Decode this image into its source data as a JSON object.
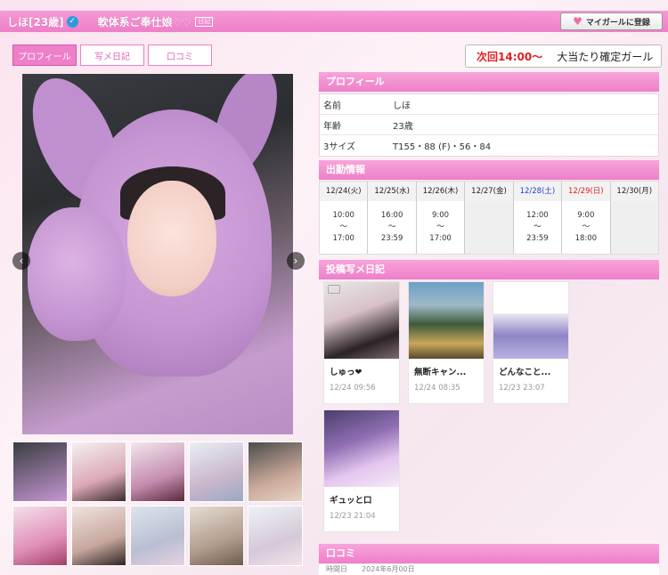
{
  "header": {
    "name_age": "しほ[23歳]",
    "catch_copy": "軟体系ご奉仕娘♡♡",
    "badge": "日記",
    "mygirl_button": "マイガールに登録"
  },
  "tabs": [
    {
      "label": "プロフィール"
    },
    {
      "label": "写メ日記"
    },
    {
      "label": "口コミ"
    }
  ],
  "next_attendance": {
    "time": "次回14:00〜",
    "label": "大当たり確定ガール"
  },
  "profile": {
    "heading": "プロフィール",
    "rows": [
      {
        "key": "名前",
        "value": "しほ"
      },
      {
        "key": "年齢",
        "value": "23歳"
      },
      {
        "key": "3サイズ",
        "value": "T155・88 (F)・56・84"
      }
    ]
  },
  "schedule": {
    "heading": "出勤情報",
    "days": [
      {
        "date": "12/24(火)",
        "start": "10:00",
        "sep": "〜",
        "end": "17:00"
      },
      {
        "date": "12/25(水)",
        "start": "16:00",
        "sep": "〜",
        "end": "23:59"
      },
      {
        "date": "12/26(木)",
        "start": "9:00",
        "sep": "〜",
        "end": "17:00"
      },
      {
        "date": "12/27(金)",
        "start": "",
        "sep": "",
        "end": ""
      },
      {
        "date": "12/28(土)",
        "start": "12:00",
        "sep": "〜",
        "end": "23:59"
      },
      {
        "date": "12/29(日)",
        "start": "9:00",
        "sep": "〜",
        "end": "18:00"
      },
      {
        "date": "12/30(月)",
        "start": "",
        "sep": "",
        "end": ""
      }
    ]
  },
  "diary": {
    "heading": "投稿写メ日記",
    "posts": [
      {
        "title": "しゅっ❤",
        "date": "12/24 09:56"
      },
      {
        "title": "無断キャン...",
        "date": "12/24 08:35"
      },
      {
        "title": "どんなこと...",
        "date": "12/23 23:07"
      },
      {
        "title": "ギュッと口",
        "date": "12/23 21:04"
      }
    ]
  },
  "kuchikomi": {
    "heading": "口コミ",
    "snippet": "時間日　　2024年6月00日"
  },
  "icons": {
    "verify": "check-badge-icon",
    "heart": "heart-icon",
    "prev": "chevron-left-icon",
    "next": "chevron-right-icon",
    "camera": "camera-icon"
  }
}
